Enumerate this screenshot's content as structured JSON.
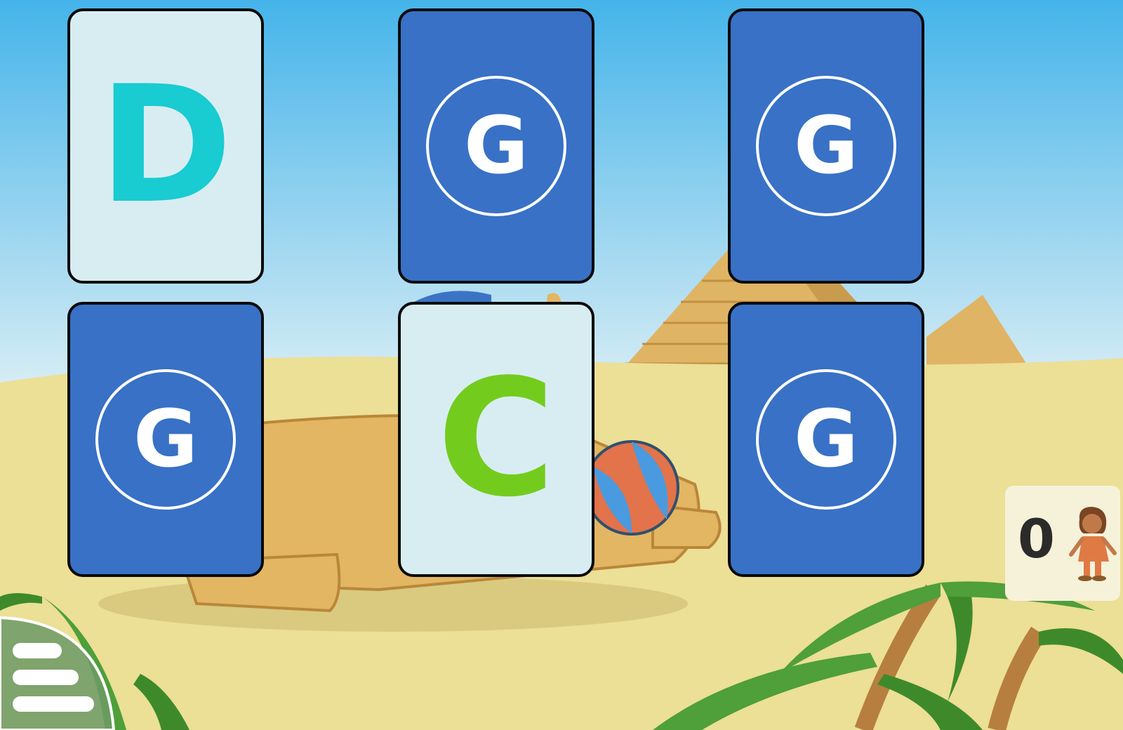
{
  "game": {
    "cards": [
      {
        "state": "face",
        "letter": "D",
        "color": "#18ccd2"
      },
      {
        "state": "back",
        "icon": "g-logo-icon"
      },
      {
        "state": "back",
        "icon": "g-logo-icon"
      },
      {
        "state": "back",
        "icon": "g-logo-icon"
      },
      {
        "state": "face",
        "letter": "C",
        "color": "#73cc1d"
      },
      {
        "state": "back",
        "icon": "g-logo-icon"
      }
    ],
    "card_back_glyph": "G",
    "card_back_color": "#3871c6",
    "card_face_color": "#d8edf2"
  },
  "score": {
    "value": "0",
    "icon": "player-avatar-icon"
  },
  "menu": {
    "icon": "hamburger-menu-icon"
  },
  "background": {
    "scene": "egyptian-desert-sphinx-pyramid"
  }
}
